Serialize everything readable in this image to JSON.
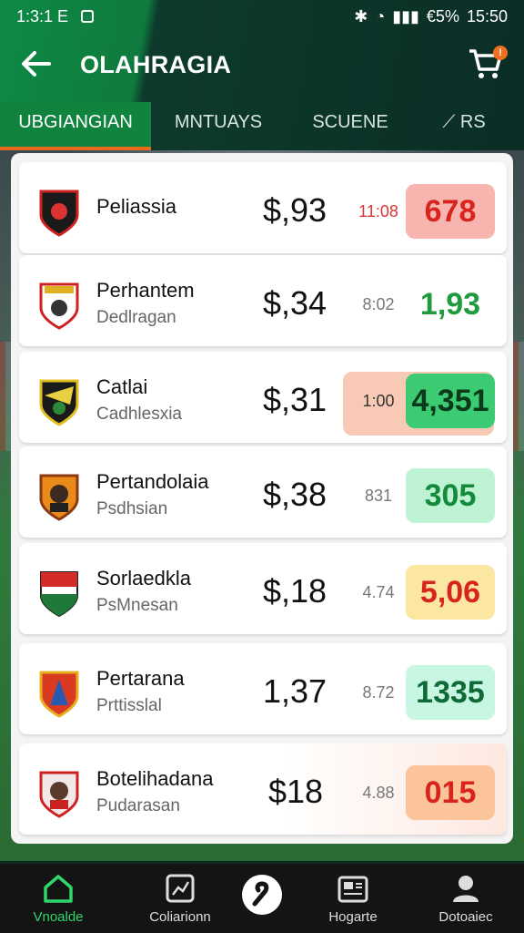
{
  "status_bar": {
    "left": "1:3:1 E",
    "right": "15:50",
    "battery": "€5%"
  },
  "header": {
    "title": "OLAHRAGIA",
    "cart_badge": "!"
  },
  "tabs": [
    {
      "label": "UBGIANGIAN",
      "active": true
    },
    {
      "label": "MNTUAYS",
      "active": false
    },
    {
      "label": "SCUENE",
      "active": false
    },
    {
      "label": "RS",
      "active": false
    }
  ],
  "rows": [
    {
      "name": "Peliassia",
      "sub": "",
      "price": "$,93",
      "time": "11:08",
      "time_color": "#dd3333",
      "odds": "678",
      "odds_bg": "#f8b4ae",
      "odds_color": "#d8241c"
    },
    {
      "name": "Perhantem",
      "sub": "Dedlragan",
      "price": "$,34",
      "time": "8:02",
      "time_color": "#777777",
      "odds": "1,93",
      "odds_bg": "#ffffff",
      "odds_color": "#1f9a3c"
    },
    {
      "name": "Catlai",
      "sub": "Cadhlesxia",
      "price": "$,31",
      "time": "1:00",
      "time_color": "#333333",
      "odds": "4,351",
      "odds_bg": "#3ccb72",
      "odds_color": "#0b3a1a"
    },
    {
      "name": "Pertandolaia",
      "sub": "Psdhsian",
      "price": "$,38",
      "time": "831",
      "time_color": "#777777",
      "odds": "305",
      "odds_bg": "#bdf2d2",
      "odds_color": "#148a3c"
    },
    {
      "name": "Sorlaedkla",
      "sub": "PsMnesan",
      "price": "$,18",
      "time": "4.74",
      "time_color": "#777777",
      "odds": "5,06",
      "odds_bg": "#fbe7a2",
      "odds_color": "#d8241c"
    },
    {
      "name": "Pertarana",
      "sub": "Prttisslal",
      "price": "1,37",
      "time": "8.72",
      "time_color": "#777777",
      "odds": "1335",
      "odds_bg": "#c7f6e3",
      "odds_color": "#0f6a36"
    },
    {
      "name": "Botelihadana",
      "sub": "Pudarasan",
      "price": "$18",
      "time": "4.88",
      "time_color": "#777777",
      "odds": "015",
      "odds_bg": "#fbc49b",
      "odds_color": "#d8241c"
    }
  ],
  "nav": [
    {
      "label": "Vnoalde",
      "icon": "home-icon",
      "active": true
    },
    {
      "label": "Coliarionn",
      "icon": "chart-icon",
      "active": false
    },
    {
      "label": "",
      "icon": "center-action-icon",
      "active": false
    },
    {
      "label": "Hogarte",
      "icon": "news-icon",
      "active": false
    },
    {
      "label": "Dotoaiec",
      "icon": "profile-icon",
      "active": false
    }
  ]
}
